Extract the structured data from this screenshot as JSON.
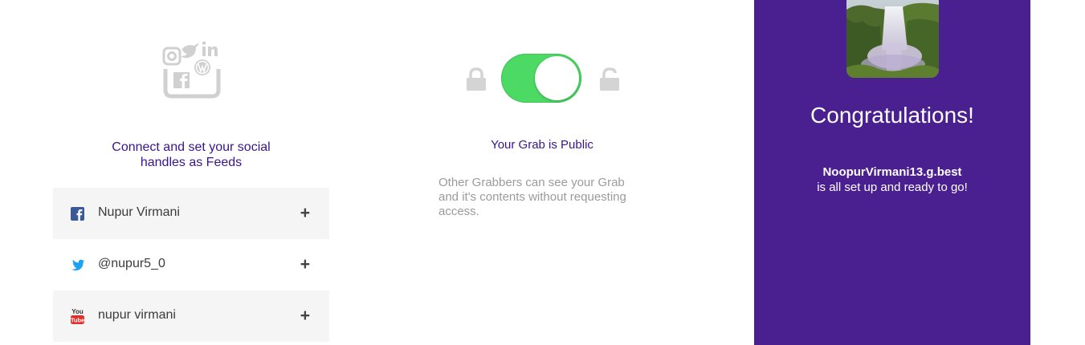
{
  "social_panel": {
    "hero_icon": "social-bundle-icon",
    "connect_text_line1": "Connect and set your social",
    "connect_text_line2": "handles as Feeds",
    "feeds": [
      {
        "platform": "facebook",
        "icon": "facebook-icon",
        "handle": "Nupur Virmani",
        "action": "+"
      },
      {
        "platform": "twitter",
        "icon": "twitter-icon",
        "handle": "@nupur5_0",
        "action": "+"
      },
      {
        "platform": "youtube",
        "icon": "youtube-icon",
        "handle": "nupur virmani",
        "action": "+",
        "icon_text_top": "You",
        "icon_text_bottom": "Tube"
      }
    ]
  },
  "privacy_panel": {
    "toggle_on": true,
    "lock_left_icon": "lock-closed-icon",
    "lock_right_icon": "lock-open-icon",
    "status_title": "Your Grab is Public",
    "description_line1": "Other Grabbers can see your Grab",
    "description_line2": "and it's contents without requesting",
    "description_line3": "access."
  },
  "congrats_panel": {
    "photo": "waterfall-photo",
    "title": "Congratulations!",
    "username": "NoopurVirmani13.g.best",
    "message": "is all set up and ready to go!"
  },
  "colors": {
    "accent_purple": "#4a1f8f",
    "heading_purple": "#3a1490",
    "toggle_green": "#4cd964",
    "row_shade": "#f5f5f5",
    "muted_gray": "#9b9b9b",
    "icon_gray": "#cfcfcf",
    "facebook_blue": "#3b5998",
    "twitter_blue": "#1da1f2",
    "youtube_red": "#e52d27"
  }
}
